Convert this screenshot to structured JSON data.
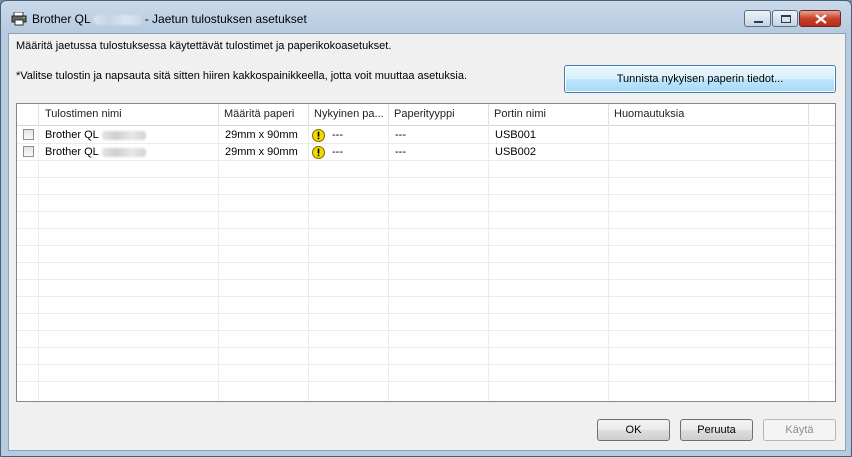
{
  "window": {
    "title_prefix": "Brother QL",
    "title_suffix": "- Jaetun tulostuksen asetukset"
  },
  "dialog": {
    "description": "Määritä jaetussa tulostuksessa käytettävät tulostimet ja paperikokoasetukset.",
    "hint": "*Valitse tulostin ja napsauta sitä sitten hiiren kakkospainikkeella, jotta voit muuttaa asetuksia.",
    "detect_button": "Tunnista nykyisen paperin tiedot..."
  },
  "table": {
    "columns": [
      "Tulostimen nimi",
      "Määritä paperi",
      "Nykyinen pa...",
      "Paperityyppi",
      "Portin nimi",
      "Huomautuksia"
    ],
    "rows": [
      {
        "name": "Brother QL",
        "paper": "29mm x 90mm",
        "current": "---",
        "type": "---",
        "port": "USB001",
        "notes": ""
      },
      {
        "name": "Brother QL",
        "paper": "29mm x 90mm",
        "current": "---",
        "type": "---",
        "port": "USB002",
        "notes": ""
      }
    ]
  },
  "buttons": {
    "ok": "OK",
    "cancel": "Peruuta",
    "apply": "Käytä"
  },
  "icons": {
    "app": "printer-icon",
    "warning": "warning-icon",
    "warning_color": "#f5d800"
  }
}
